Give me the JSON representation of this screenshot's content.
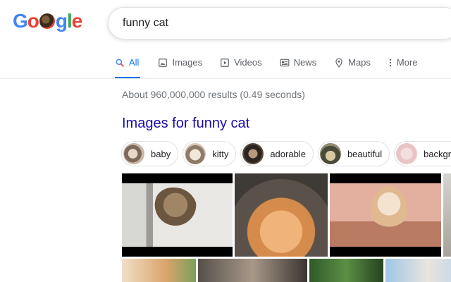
{
  "logo": {
    "letters": [
      "G",
      "o",
      "o",
      "g",
      "l",
      "e"
    ]
  },
  "search": {
    "query": "funny cat",
    "placeholder": ""
  },
  "tabs": [
    {
      "label": "All",
      "icon": "search-icon",
      "active": true
    },
    {
      "label": "Images",
      "icon": "image-icon"
    },
    {
      "label": "Videos",
      "icon": "video-icon"
    },
    {
      "label": "News",
      "icon": "news-icon"
    },
    {
      "label": "Maps",
      "icon": "map-pin-icon"
    },
    {
      "label": "More",
      "icon": "more-vert-icon"
    }
  ],
  "stats": "About 960,000,000 results (0.49 seconds)",
  "images_heading": "Images for funny cat",
  "chips": [
    {
      "label": "baby"
    },
    {
      "label": "kitty"
    },
    {
      "label": "adorable"
    },
    {
      "label": "beautiful"
    },
    {
      "label": "backgrou"
    }
  ],
  "colors": {
    "accent": "#1a73e8",
    "link": "#1a0dab",
    "muted": "#70757a",
    "tab_text": "#5f6368"
  }
}
